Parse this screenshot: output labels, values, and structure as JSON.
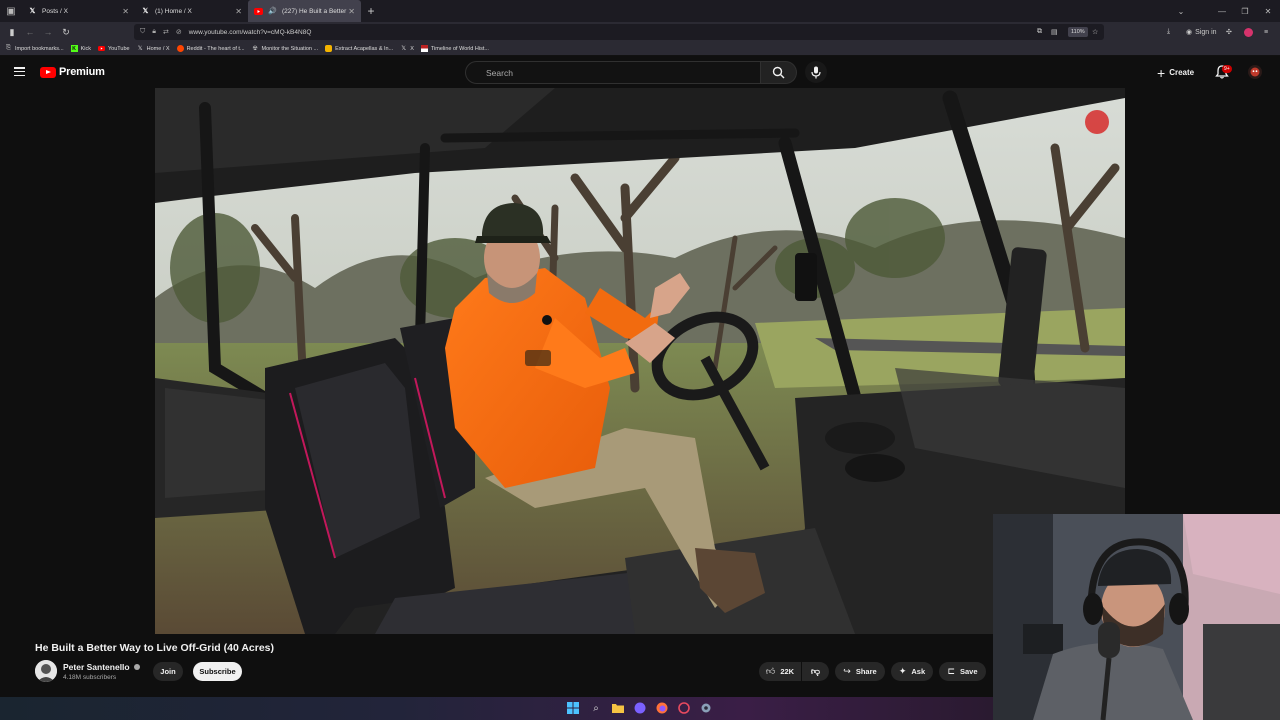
{
  "browser": {
    "tabs": [
      {
        "label": "Posts / X",
        "favicon": "x-logo"
      },
      {
        "label": "(1) Home / X",
        "favicon": "x-logo"
      },
      {
        "label": "(227) He Built a Better Way",
        "favicon": "youtube-logo"
      }
    ],
    "url": "www.youtube.com/watch?v=cMQ-kB4N8Q",
    "zoom": "110%",
    "sign_in": "Sign in",
    "bookmarks": [
      {
        "label": "Import bookmarks...",
        "icon": "import-icon"
      },
      {
        "label": "Kick",
        "icon": "kick-logo"
      },
      {
        "label": "YouTube",
        "icon": "youtube-logo"
      },
      {
        "label": "Home / X",
        "icon": "x-logo"
      },
      {
        "label": "Reddit - The heart of t...",
        "icon": "reddit-logo"
      },
      {
        "label": "Monitor the Situation ...",
        "icon": "monitor-icon"
      },
      {
        "label": "Extract Acapellas & In...",
        "icon": "music-icon"
      },
      {
        "label": "X",
        "icon": "x-logo"
      },
      {
        "label": "Timeline of World Hist...",
        "icon": "flag-icon"
      }
    ]
  },
  "youtube": {
    "logo_text": "Premium",
    "search_placeholder": "Search",
    "create_label": "Create",
    "notification_count": "9+",
    "video": {
      "title": "He Built a Better Way to Live Off-Grid (40 Acres)",
      "channel_name": "Peter Santenello",
      "subscribers": "4.18M subscribers",
      "join_label": "Join",
      "subscribe_label": "Subscribe",
      "likes": "22K",
      "share_label": "Share",
      "ask_label": "Ask",
      "save_label": "Save"
    }
  },
  "colors": {
    "youtube_red": "#ff0000",
    "background": "#0f0f0f",
    "pill": "#272727"
  }
}
